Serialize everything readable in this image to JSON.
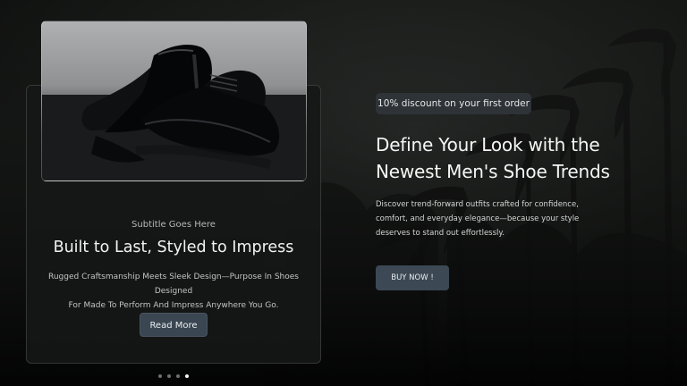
{
  "hero": {
    "badge": "10% discount on your first order",
    "headline_line1": "Define Your Look with the",
    "headline_line2": "Newest Men's Shoe Trends",
    "description_line1": "Discover trend-forward outfits crafted for confidence,",
    "description_line2": "comfort, and everyday elegance—because your style",
    "description_line3": "deserves to stand out effortlessly.",
    "cta_label": "BUY NOW !"
  },
  "card": {
    "subtitle": "Subtitle Goes Here",
    "title": "Built to Last, Styled to Impress",
    "text_line1": "Rugged Craftsmanship Meets Sleek Design—Purpose In Shoes Designed",
    "text_line2": "For Made To Perform And Impress Anywhere You Go.",
    "button_label": "Read More",
    "image_icon": "black-leather-oxford-shoes"
  },
  "carousel": {
    "slide_count": 4,
    "active_slide": 4
  },
  "colors": {
    "background": "#0a0b0a",
    "button": "#3a4651",
    "badge": "#2e3338",
    "active_dot": "#f4f4f4"
  }
}
